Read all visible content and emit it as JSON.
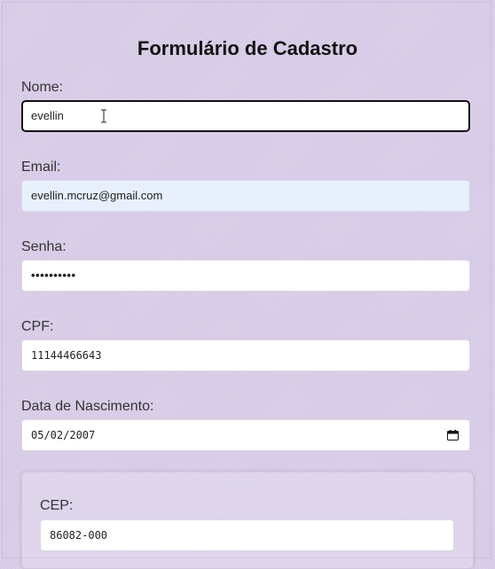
{
  "form": {
    "title": "Formulário de Cadastro",
    "fields": {
      "nome": {
        "label": "Nome:",
        "value": "evellin"
      },
      "email": {
        "label": "Email:",
        "value": "evellin.mcruz@gmail.com"
      },
      "senha": {
        "label": "Senha:",
        "value": "••••••••••"
      },
      "cpf": {
        "label": "CPF:",
        "value": "11144466643"
      },
      "nascimento": {
        "label": "Data de Nascimento:",
        "value": "05/02/2007"
      },
      "cep": {
        "label": "CEP:",
        "value": "86082-000"
      }
    }
  },
  "icons": {
    "cursor": "text-cursor-icon",
    "date_picker": "calendar-icon"
  },
  "colors": {
    "background": "#d9cde8",
    "focus_border": "#111111",
    "autofill_background": "#e8f0fe"
  }
}
